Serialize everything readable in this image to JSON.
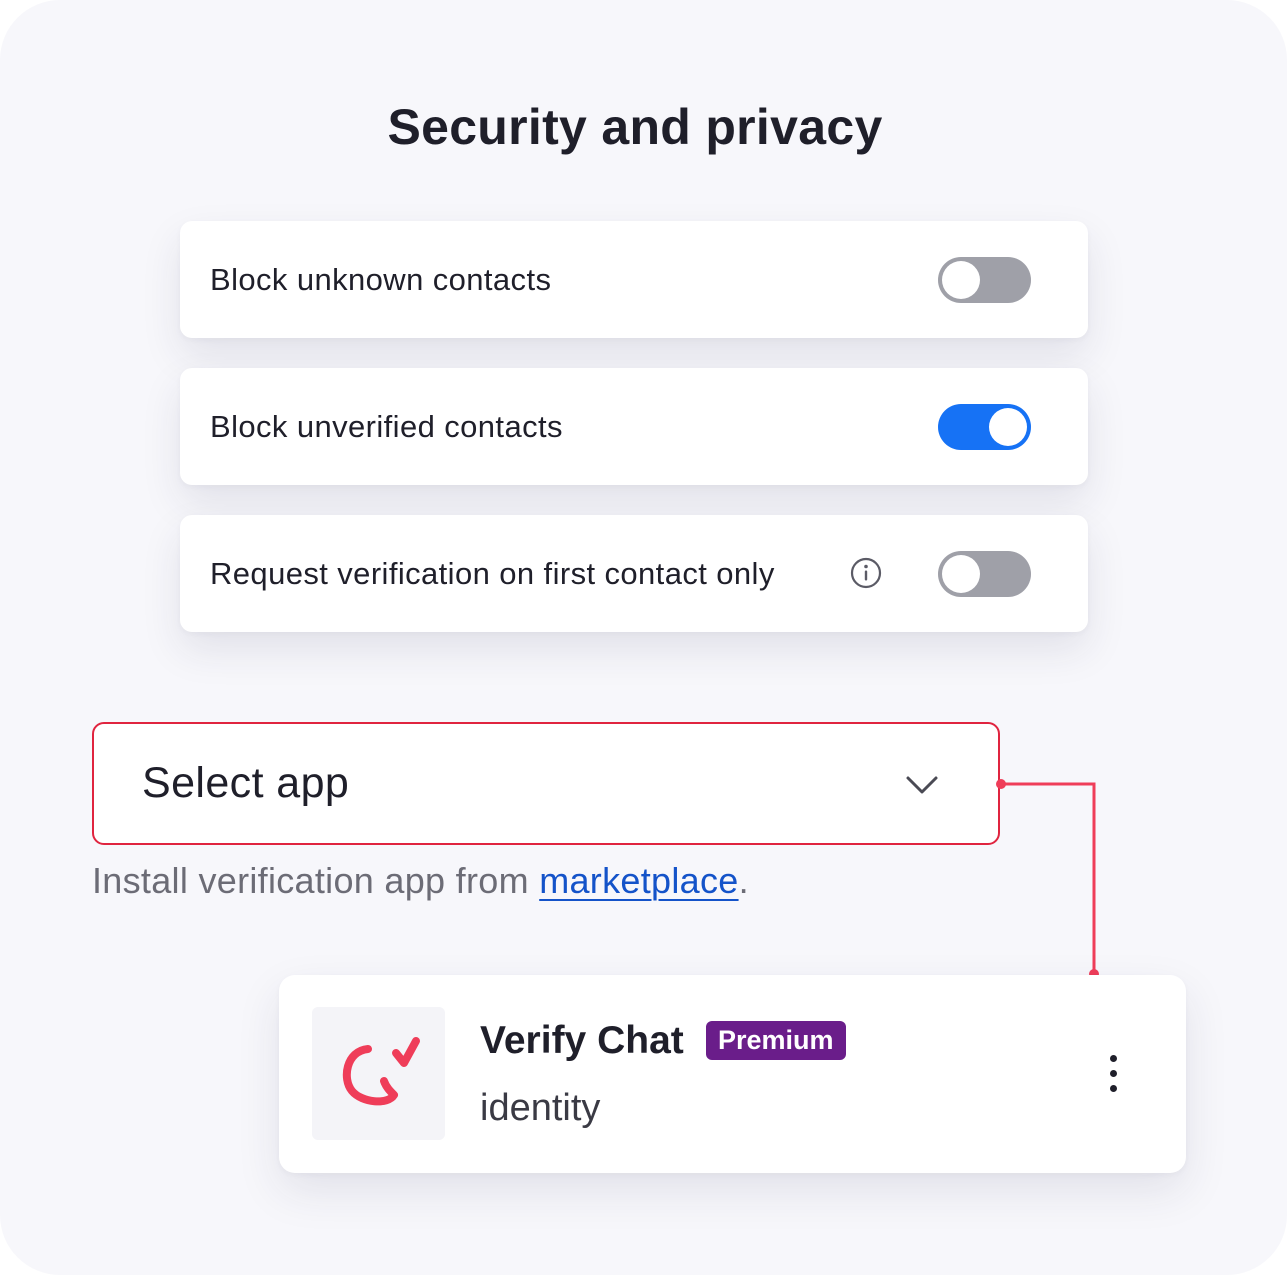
{
  "title": "Security and privacy",
  "settings": [
    {
      "label": "Block unknown contacts",
      "enabled": false
    },
    {
      "label": "Block unverified contacts",
      "enabled": true
    },
    {
      "label": "Request verification on first contact only",
      "enabled": false,
      "has_info_icon": true
    }
  ],
  "select": {
    "value": "Select app",
    "icon": "chevron-down-icon"
  },
  "helper": {
    "prefix": "Install verification app from ",
    "link_text": "marketplace",
    "suffix": "."
  },
  "app": {
    "name": "Verify Chat",
    "badge": "Premium",
    "subtitle": "identity",
    "logo_icon": "verify-chat-logo-icon",
    "menu_icon": "more-vertical-icon"
  },
  "colors": {
    "accent_blue": "#1672f5",
    "toggle_off": "#9fa0a8",
    "focus_red": "#e0243f",
    "link_blue": "#1453c9",
    "badge_purple": "#6a1d8a",
    "logo_red": "#ef3d59"
  }
}
